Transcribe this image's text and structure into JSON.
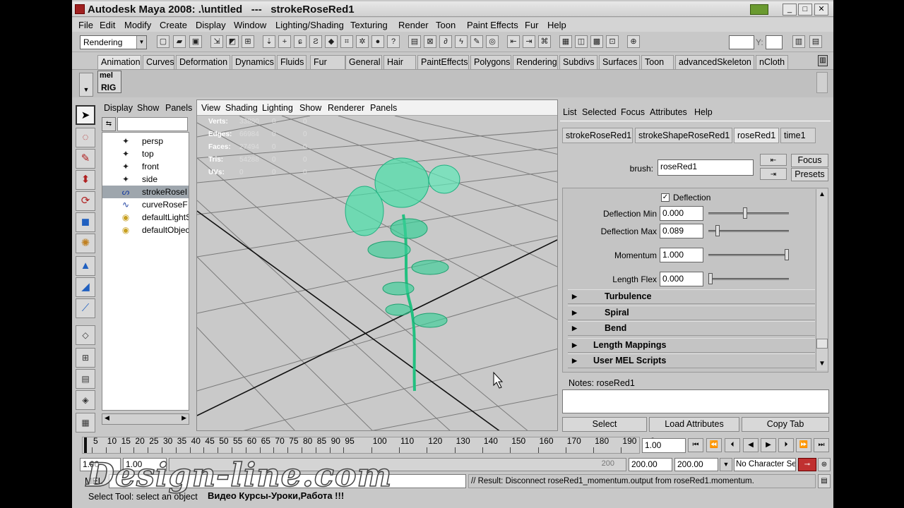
{
  "window": {
    "title": "Autodesk Maya 2008: .\\untitled   ---   strokeRoseRed1",
    "min": "_",
    "max": "□",
    "close": "✕"
  },
  "menubar": [
    "File",
    "Edit",
    "Modify",
    "Create",
    "Display",
    "Window",
    "Lighting/Shading",
    "Texturing",
    "Render",
    "Toon",
    "Paint Effects",
    "Fur",
    "Help"
  ],
  "toolbar": {
    "menuset": "Rendering",
    "y_label": "Y:"
  },
  "shelf": {
    "tabs": [
      "Animation",
      "Curves",
      "Deformation",
      "Dynamics",
      "Fluids",
      "Fur",
      "General",
      "Hair",
      "PaintEffects",
      "Polygons",
      "Rendering",
      "Subdivs",
      "Surfaces",
      "Toon",
      "advancedSkeleton",
      "nCloth"
    ],
    "active_tab": "Animation",
    "mel_label": "mel",
    "rig_label": "RIG"
  },
  "outliner": {
    "menu": [
      "Display",
      "Show",
      "Panels"
    ],
    "items": [
      {
        "label": "persp",
        "icon": "camera-icon"
      },
      {
        "label": "top",
        "icon": "camera-icon"
      },
      {
        "label": "front",
        "icon": "camera-icon"
      },
      {
        "label": "side",
        "icon": "camera-icon"
      },
      {
        "label": "strokeRoseI",
        "icon": "stroke-icon"
      },
      {
        "label": "curveRoseF",
        "icon": "curve-icon"
      },
      {
        "label": "defaultLightS",
        "icon": "set-icon"
      },
      {
        "label": "defaultObjec",
        "icon": "set-icon"
      }
    ],
    "selected_index": 4
  },
  "viewport": {
    "menu": [
      "View",
      "Shading",
      "Lighting",
      "Show",
      "Renderer",
      "Panels"
    ],
    "hud": [
      {
        "label": "Verts:",
        "values": [
          "33880",
          "0",
          "0"
        ]
      },
      {
        "label": "Edges:",
        "values": [
          "66984",
          "0",
          "0"
        ]
      },
      {
        "label": "Faces:",
        "values": [
          "27494",
          "0",
          "0"
        ]
      },
      {
        "label": "Tris:",
        "values": [
          "54288",
          "0",
          "0"
        ]
      },
      {
        "label": "UVs:",
        "values": [
          "0",
          "0",
          "0"
        ]
      }
    ]
  },
  "attribute_editor": {
    "menu": [
      "List",
      "Selected",
      "Focus",
      "Attributes",
      "Help"
    ],
    "tabs": [
      "strokeRoseRed1",
      "strokeShapeRoseRed1",
      "roseRed1",
      "time1"
    ],
    "active_tab": "roseRed1",
    "brush_label": "brush:",
    "brush_value": "roseRed1",
    "focus_button": "Focus",
    "presets_button": "Presets",
    "deflection_checkbox": "Deflection",
    "fields": [
      {
        "label": "Deflection Min",
        "value": "0.000",
        "level": 0.45
      },
      {
        "label": "Deflection Max",
        "value": "0.089",
        "level": 0.09
      },
      {
        "label": "Momentum",
        "value": "1.000",
        "level": 1.0
      },
      {
        "label": "Length Flex",
        "value": "0.000",
        "level": 0.0
      }
    ],
    "sections": [
      "Turbulence",
      "Spiral",
      "Bend",
      "Length Mappings",
      "User MEL Scripts"
    ],
    "notes_label": "Notes:  roseRed1",
    "select_button": "Select",
    "load_attributes_button": "Load Attributes",
    "copy_tab_button": "Copy Tab"
  },
  "timeline": {
    "ticks": [
      "5",
      "10",
      "15",
      "20",
      "25",
      "30",
      "35",
      "40",
      "45",
      "50",
      "55",
      "60",
      "65",
      "70",
      "75",
      "80",
      "85",
      "90",
      "95",
      "100",
      "110",
      "120",
      "130",
      "140",
      "150",
      "160",
      "170",
      "180",
      "190",
      "2"
    ],
    "current_frame": "1.00"
  },
  "range": {
    "start": "1.00",
    "inner_start": "1.00",
    "inner_end": "200.00",
    "end": "200.00",
    "slider_end_label": "200",
    "character": "No Character Se"
  },
  "command": {
    "mel_label": "MEL",
    "result": "// Result: Disconnect roseRed1_momentum.output from roseRed1.momentum."
  },
  "help": {
    "text": "Select Tool: select an object"
  },
  "watermark": {
    "title": "Design-line.com",
    "subtitle": "Видео Курсы-Уроки,Работа !!!"
  }
}
